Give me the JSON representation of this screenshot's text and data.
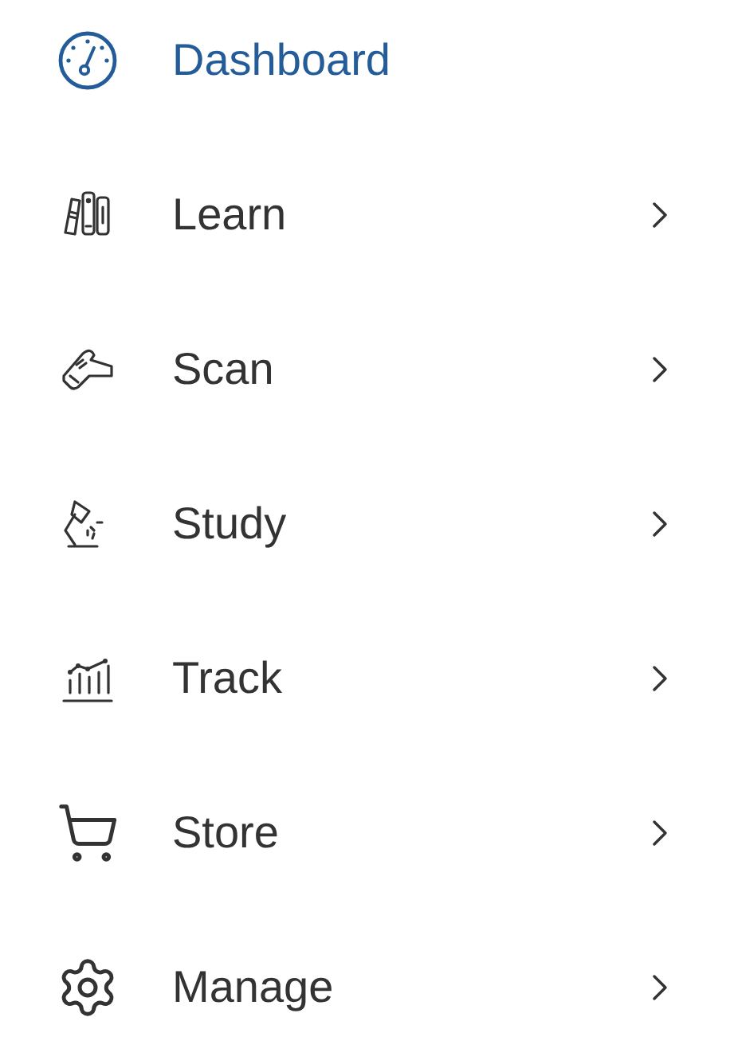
{
  "menu": {
    "items": [
      {
        "label": "Dashboard",
        "kind": "gauge",
        "selected": true,
        "has_submenu": false
      },
      {
        "label": "Learn",
        "kind": "books",
        "selected": false,
        "has_submenu": true
      },
      {
        "label": "Scan",
        "kind": "scanner",
        "selected": false,
        "has_submenu": true
      },
      {
        "label": "Study",
        "kind": "lamp",
        "selected": false,
        "has_submenu": true
      },
      {
        "label": "Track",
        "kind": "chart",
        "selected": false,
        "has_submenu": true
      },
      {
        "label": "Store",
        "kind": "cart",
        "selected": false,
        "has_submenu": true
      },
      {
        "label": "Manage",
        "kind": "gear",
        "selected": false,
        "has_submenu": true
      }
    ]
  }
}
